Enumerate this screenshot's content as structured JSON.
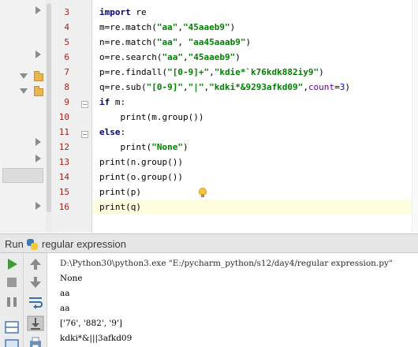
{
  "editor": {
    "lines": [
      {
        "num": "3",
        "tokens": [
          {
            "t": "import",
            "c": "kw"
          },
          {
            "t": " re",
            "c": ""
          }
        ]
      },
      {
        "num": "4",
        "tokens": [
          {
            "t": "m=re.match(",
            "c": ""
          },
          {
            "t": "\"aa\"",
            "c": "str"
          },
          {
            "t": ",",
            "c": ""
          },
          {
            "t": "\"45aaeb9\"",
            "c": "str"
          },
          {
            "t": ")",
            "c": ""
          }
        ]
      },
      {
        "num": "5",
        "tokens": [
          {
            "t": "n=re.match(",
            "c": ""
          },
          {
            "t": "\"aa\"",
            "c": "str"
          },
          {
            "t": ", ",
            "c": ""
          },
          {
            "t": "\"aa45aaab9\"",
            "c": "str"
          },
          {
            "t": ")",
            "c": ""
          }
        ]
      },
      {
        "num": "6",
        "tokens": [
          {
            "t": "o=re.search(",
            "c": ""
          },
          {
            "t": "\"aa\"",
            "c": "str"
          },
          {
            "t": ",",
            "c": ""
          },
          {
            "t": "\"45aaeb9\"",
            "c": "str"
          },
          {
            "t": ")",
            "c": ""
          }
        ]
      },
      {
        "num": "7",
        "tokens": [
          {
            "t": "p=re.findall(",
            "c": ""
          },
          {
            "t": "\"[0-9]+\"",
            "c": "str"
          },
          {
            "t": ",",
            "c": ""
          },
          {
            "t": "\"kdie*`k76kdk882iy9\"",
            "c": "str"
          },
          {
            "t": ")",
            "c": ""
          }
        ]
      },
      {
        "num": "8",
        "tokens": [
          {
            "t": "q=re.sub(",
            "c": ""
          },
          {
            "t": "\"[0-9]\"",
            "c": "str"
          },
          {
            "t": ",",
            "c": ""
          },
          {
            "t": "\"|\"",
            "c": "str"
          },
          {
            "t": ",",
            "c": ""
          },
          {
            "t": "\"kdki*&9293afkd09\"",
            "c": "str"
          },
          {
            "t": ",",
            "c": ""
          },
          {
            "t": "count",
            "c": "kwarg"
          },
          {
            "t": "=",
            "c": ""
          },
          {
            "t": "3",
            "c": "num"
          },
          {
            "t": ")",
            "c": ""
          }
        ]
      },
      {
        "num": "9",
        "tokens": [
          {
            "t": "if",
            "c": "kw"
          },
          {
            "t": " m:",
            "c": ""
          }
        ]
      },
      {
        "num": "10",
        "tokens": [
          {
            "t": "    print(m.group())",
            "c": ""
          }
        ]
      },
      {
        "num": "11",
        "tokens": [
          {
            "t": "else",
            "c": "kw"
          },
          {
            "t": ":",
            "c": ""
          }
        ]
      },
      {
        "num": "12",
        "tokens": [
          {
            "t": "    print(",
            "c": ""
          },
          {
            "t": "\"None\"",
            "c": "str"
          },
          {
            "t": ")",
            "c": ""
          }
        ]
      },
      {
        "num": "13",
        "tokens": [
          {
            "t": "print(n.group())",
            "c": ""
          }
        ]
      },
      {
        "num": "14",
        "tokens": [
          {
            "t": "print(o.group())",
            "c": ""
          }
        ]
      },
      {
        "num": "15",
        "tokens": [
          {
            "t": "print(p)",
            "c": ""
          }
        ]
      },
      {
        "num": "16",
        "tokens": [
          {
            "t": "print(q)",
            "c": ""
          }
        ]
      }
    ],
    "current_line": "16"
  },
  "run_panel": {
    "title": "Run",
    "config_name": "regular expression",
    "icons": {
      "config": "python-file-icon",
      "rerun": "run-icon",
      "stop": "stop-icon",
      "pause": "pause-icon",
      "layout": "layout-icon",
      "up": "arrow-up-icon",
      "down": "arrow-down-icon",
      "soft_wrap": "soft-wrap-icon",
      "scroll_end": "scroll-to-end-icon",
      "print": "print-icon"
    }
  },
  "console": {
    "lines": [
      "D:\\Python30\\python3.exe \"E:/pycharm_python/s12/day4/regular expression.py\"",
      "None",
      "aa",
      "aa",
      "['76', '882', '9']",
      "kdki*&|||3afkd09"
    ]
  },
  "colors": {
    "keyword": "#000080",
    "string": "#008000",
    "number": "#0000ff",
    "line_number": "#a2231d",
    "current_line_bg": "#ffffdf",
    "run_green": "#3f9c35"
  }
}
